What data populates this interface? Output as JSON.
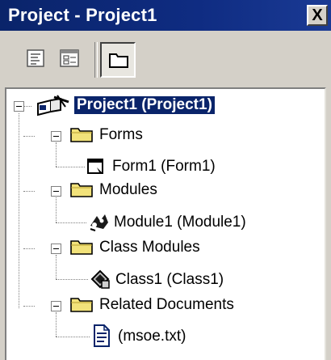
{
  "window": {
    "title": "Project - Project1",
    "close_label": "X"
  },
  "toolbar": {
    "buttons": [
      {
        "name": "view-code",
        "icon": "view-code-icon"
      },
      {
        "name": "view-object",
        "icon": "view-object-icon"
      },
      {
        "name": "toggle-folders",
        "icon": "folder-icon",
        "pressed": true
      }
    ]
  },
  "tree": {
    "root": {
      "label": "Project1 (Project1)",
      "icon": "project-icon",
      "selected": true
    },
    "folders": [
      {
        "label": "Forms",
        "icon": "folder-icon",
        "items": [
          {
            "label": "Form1 (Form1)",
            "icon": "form-icon"
          }
        ]
      },
      {
        "label": "Modules",
        "icon": "folder-icon",
        "items": [
          {
            "label": "Module1 (Module1)",
            "icon": "module-icon"
          }
        ]
      },
      {
        "label": "Class Modules",
        "icon": "folder-icon",
        "items": [
          {
            "label": "Class1 (Class1)",
            "icon": "class-icon"
          }
        ]
      },
      {
        "label": "Related Documents",
        "icon": "folder-icon",
        "items": [
          {
            "label": "(msoe.txt)",
            "icon": "document-icon"
          }
        ]
      }
    ]
  },
  "colors": {
    "titlebar": "#0a246a",
    "selection": "#0a246a",
    "chrome": "#d4d0c8"
  }
}
